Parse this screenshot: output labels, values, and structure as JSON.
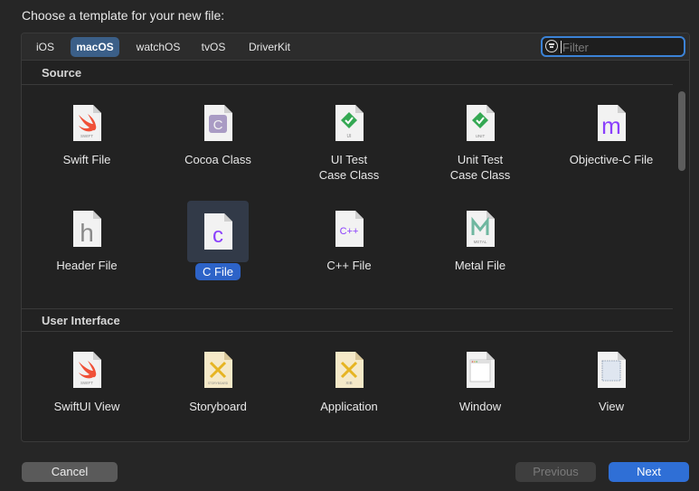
{
  "dialog": {
    "heading": "Choose a template for your new file:"
  },
  "tabs": [
    {
      "label": "iOS",
      "selected": false
    },
    {
      "label": "macOS",
      "selected": true
    },
    {
      "label": "watchOS",
      "selected": false
    },
    {
      "label": "tvOS",
      "selected": false
    },
    {
      "label": "DriverKit",
      "selected": false
    }
  ],
  "filter": {
    "placeholder": "Filter",
    "value": ""
  },
  "sections": [
    {
      "title": "Source",
      "items": [
        {
          "label": "Swift File",
          "icon": "swift-file-icon",
          "badge": "SWIFT"
        },
        {
          "label": "Cocoa Class",
          "icon": "cocoa-class-icon",
          "badge": "C"
        },
        {
          "label": "UI Test\nCase Class",
          "icon": "ui-test-icon",
          "badge": "UI"
        },
        {
          "label": "Unit Test\nCase Class",
          "icon": "unit-test-icon",
          "badge": "UNIT"
        },
        {
          "label": "Objective-C File",
          "icon": "objective-c-file-icon",
          "badge": "m"
        },
        {
          "label": "Header File",
          "icon": "header-file-icon",
          "badge": "h"
        },
        {
          "label": "C File",
          "icon": "c-file-icon",
          "badge": "c",
          "selected": true
        },
        {
          "label": "C++ File",
          "icon": "cpp-file-icon",
          "badge": "C++"
        },
        {
          "label": "Metal File",
          "icon": "metal-file-icon",
          "badge": "METAL"
        }
      ]
    },
    {
      "title": "User Interface",
      "items": [
        {
          "label": "SwiftUI View",
          "icon": "swiftui-view-icon",
          "badge": "SWIFT"
        },
        {
          "label": "Storyboard",
          "icon": "storyboard-icon",
          "badge": "STORYBOARD"
        },
        {
          "label": "Application",
          "icon": "application-icon",
          "badge": "XIB"
        },
        {
          "label": "Window",
          "icon": "window-icon",
          "badge": ""
        },
        {
          "label": "View",
          "icon": "view-icon",
          "badge": ""
        }
      ]
    }
  ],
  "buttons": {
    "cancel": "Cancel",
    "previous": "Previous",
    "next": "Next"
  },
  "colors": {
    "accent": "#2f6fd6",
    "selected_tab": "#3b5f88",
    "swift_orange": "#f05138",
    "check_green": "#34a853",
    "objc_purple": "#8a3ffc"
  }
}
